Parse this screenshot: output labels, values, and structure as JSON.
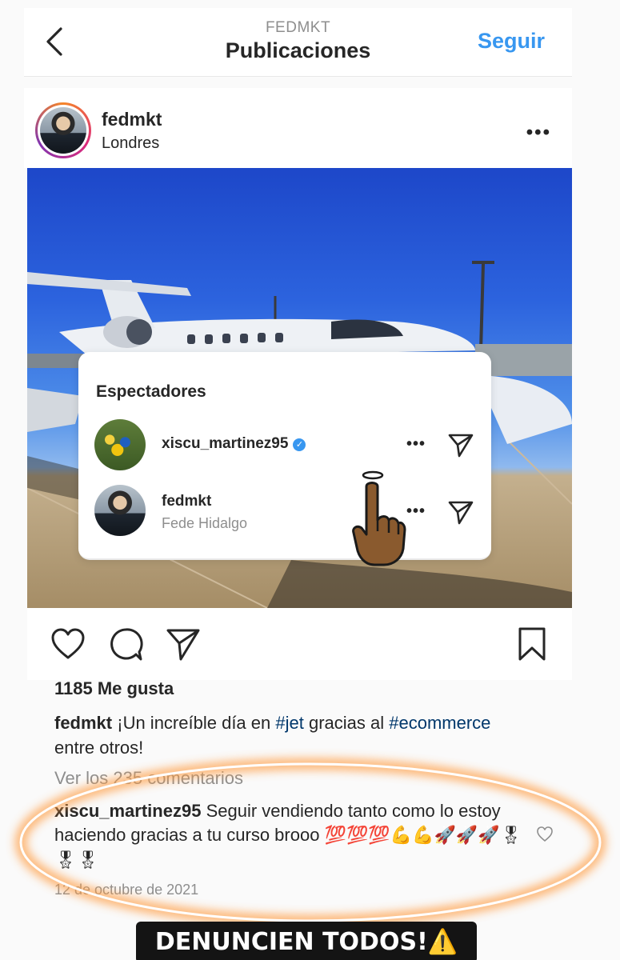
{
  "header": {
    "account": "FEDMKT",
    "title": "Publicaciones",
    "follow_label": "Seguir"
  },
  "post": {
    "username": "fedmkt",
    "location": "Londres",
    "more": "•••"
  },
  "viewers": {
    "title": "Espectadores",
    "items": [
      {
        "username": "xiscu_martinez95",
        "full_name": "",
        "verified": true
      },
      {
        "username": "fedmkt",
        "full_name": "Fede Hidalgo",
        "verified": false
      }
    ],
    "more": "•••"
  },
  "engagement": {
    "likes": "1185 Me gusta",
    "caption_user": "fedmkt",
    "caption_pre": "¡Un increíble día en ",
    "caption_tag1": "#jet",
    "caption_mid": " gracias al ",
    "caption_tag2": "#ecommerce",
    "caption_post": " entre otros!",
    "view_comments": "Ver los 235 comentarios",
    "comment_user": "xiscu_martinez95",
    "comment_text": "Seguir vendiendo tanto como lo estoy haciendo gracias a tu curso brooo",
    "comment_emojis": "💯💯💯💪💪🚀🚀🚀🎖🎖🎖",
    "date": "12 de octubre de 2021"
  },
  "banner": {
    "text": "DENUNCIEN TODOS!⚠️"
  },
  "icons": [
    "back-icon",
    "more-icon",
    "heart-icon",
    "comment-icon",
    "share-icon",
    "bookmark-icon",
    "send-icon",
    "verified-icon",
    "pointing-finger-icon",
    "small-heart-icon"
  ],
  "colors": {
    "link": "#3897f0",
    "hashtag": "#00376b",
    "muted": "#8e8e8e",
    "glow": "#ff9a3c"
  }
}
